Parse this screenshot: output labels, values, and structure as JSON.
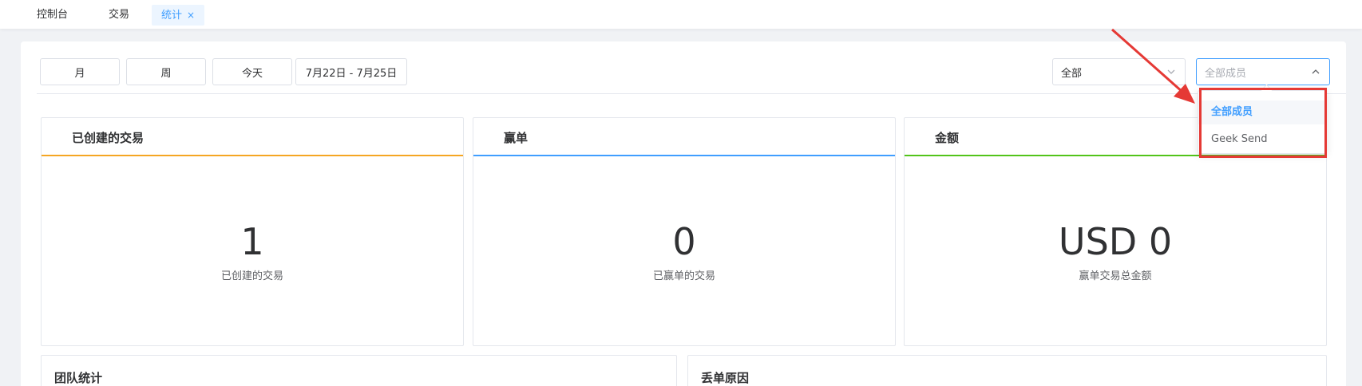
{
  "tabs": [
    {
      "label": "控制台"
    },
    {
      "label": "交易"
    },
    {
      "label": "统计",
      "close": "×"
    }
  ],
  "toolbar": {
    "month": "月",
    "week": "周",
    "today": "今天",
    "date_range": "7月22日 - 7月25日",
    "scope_select": {
      "value": "全部"
    },
    "member_select": {
      "placeholder": "全部成员"
    }
  },
  "panels": [
    {
      "title": "已创建的交易",
      "value": "1",
      "subtitle": "已创建的交易",
      "accent": "#f5a623"
    },
    {
      "title": "赢单",
      "value": "0",
      "subtitle": "已赢单的交易",
      "accent": "#409eff"
    },
    {
      "title": "金额",
      "value": "USD 0",
      "subtitle": "赢单交易总金额",
      "accent": "#52c41a"
    }
  ],
  "bottom_panels": [
    {
      "title": "团队统计"
    },
    {
      "title": "丢单原因"
    }
  ],
  "member_dropdown": {
    "options": [
      {
        "label": "全部成员",
        "selected": true
      },
      {
        "label": "Geek Send",
        "selected": false
      }
    ]
  },
  "colors": {
    "primary": "#409eff",
    "annotation": "#e53935"
  }
}
